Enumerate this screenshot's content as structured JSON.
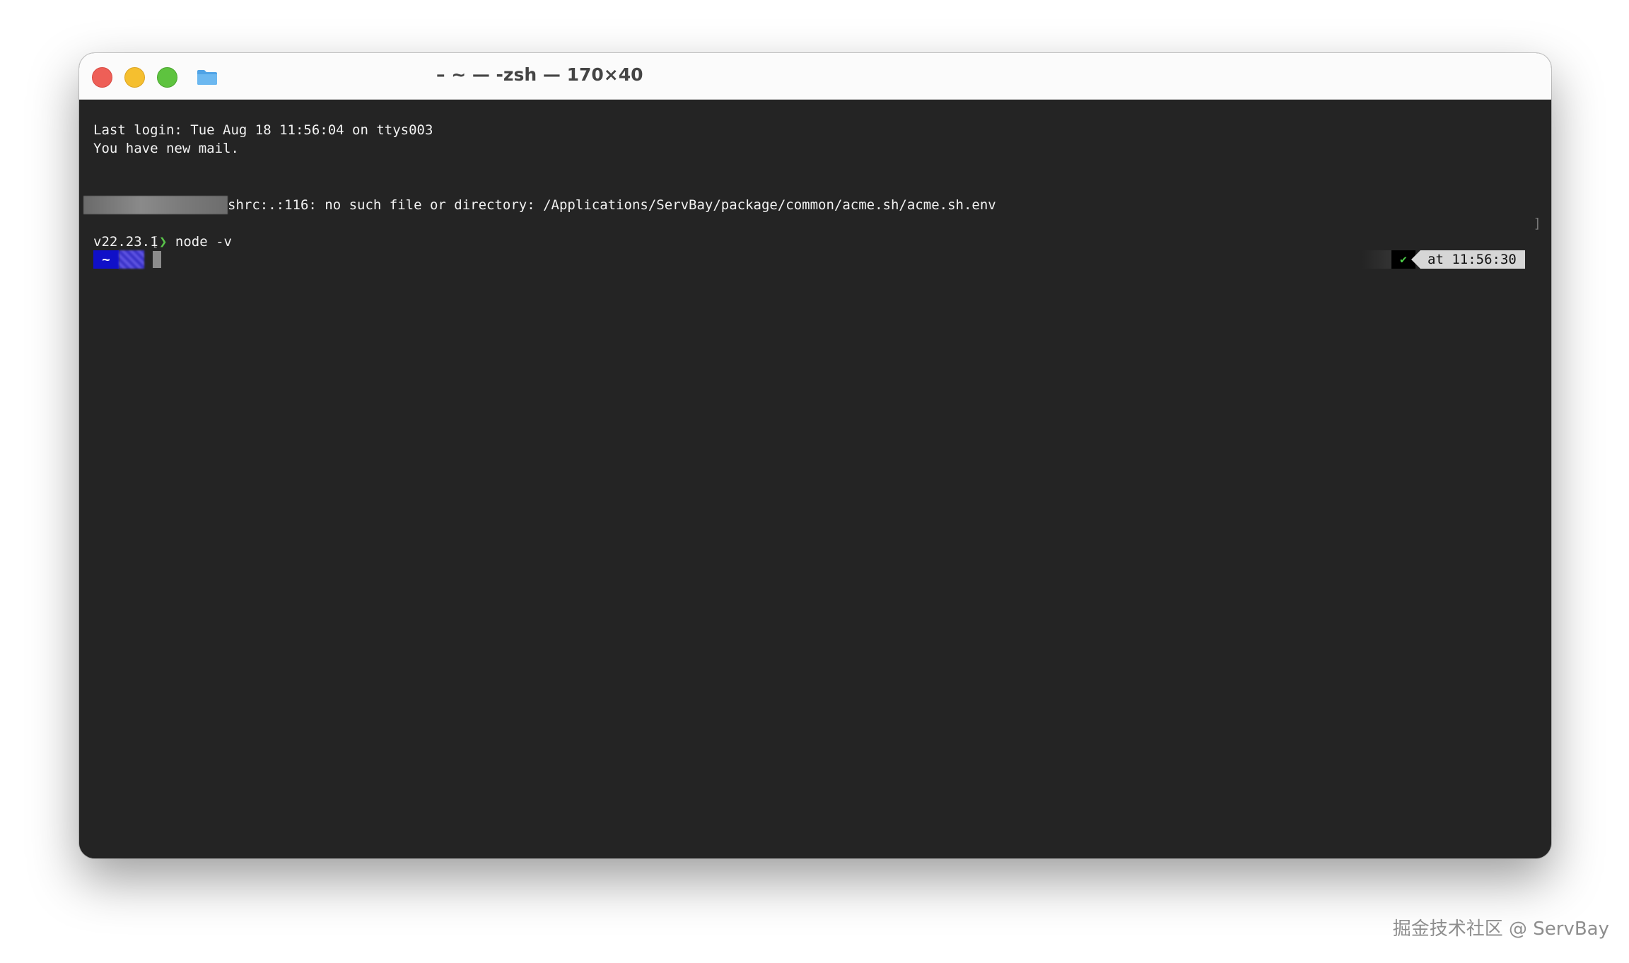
{
  "window": {
    "title": "– ~ — -zsh — 170×40"
  },
  "icons": {
    "close": "close-button",
    "minimize": "minimize-button",
    "maximize": "zoom-button",
    "folder": "folder-icon"
  },
  "terminal": {
    "lines": [
      "Last login: Tue Aug 18 11:56:04 on ttys003",
      "You have new mail.",
      "shrc:.:116: no such file or directory: /Applications/ServBay/package/common/acme.sh/acme.sh.env"
    ],
    "command_bracket": "[",
    "command_chevron": "❯",
    "command": "node -v",
    "output": "v22.23.1",
    "right_bracket": "]",
    "prompt_dir": "~",
    "status_check": "✔",
    "status_time": "at 11:56:30"
  },
  "colors": {
    "terminal_bg": "#242424",
    "prompt_dir_bg": "#1010c8",
    "check_green": "#4fd14a"
  },
  "watermark": "掘金技术社区 @ ServBay"
}
